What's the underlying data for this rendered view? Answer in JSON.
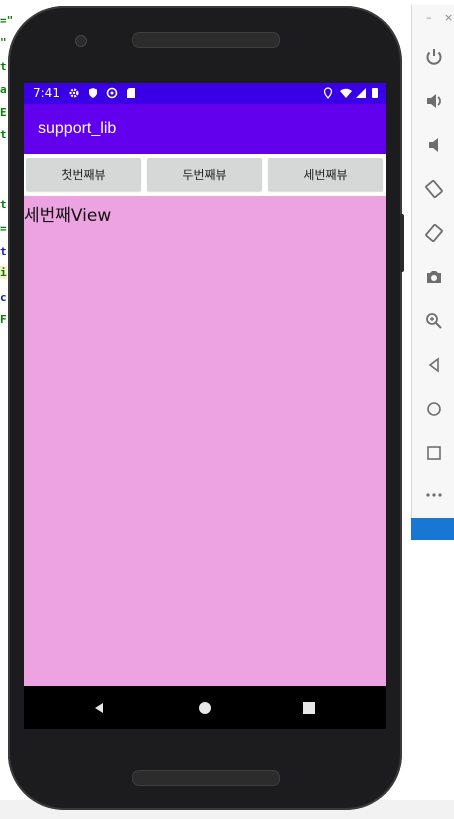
{
  "ide": {
    "code_fragments": [
      "=\"",
      "\"",
      "t",
      "a",
      "E",
      "t",
      "t",
      "=",
      "t",
      "i",
      "c",
      "F"
    ]
  },
  "status_bar": {
    "time": "7:41",
    "icons": [
      "gear-icon",
      "shield-icon",
      "sync-icon",
      "sd-card-icon",
      "location-icon",
      "wifi-icon",
      "signal-icon",
      "battery-icon"
    ]
  },
  "app_bar": {
    "title": "support_lib"
  },
  "buttons": {
    "first": "첫번째뷰",
    "second": "두번째뷰",
    "third": "세번째뷰"
  },
  "content": {
    "text": "세번째View",
    "background": "#eda3e1"
  },
  "emulator_toolbar": {
    "items": [
      "power-icon",
      "volume-up-icon",
      "volume-down-icon",
      "rotate-left-icon",
      "rotate-right-icon",
      "camera-icon",
      "zoom-icon",
      "back-icon",
      "home-icon",
      "overview-icon",
      "more-icon"
    ]
  },
  "colors": {
    "status_bar": "#3a00e5",
    "app_bar": "#6200ee",
    "button": "#d6d7d7",
    "nav_bar": "#000000"
  }
}
